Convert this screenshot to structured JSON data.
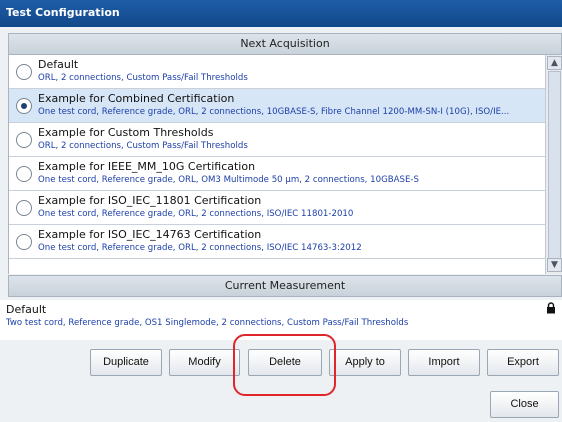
{
  "window": {
    "title": "Test Configuration"
  },
  "next_acquisition": {
    "header": "Next Acquisition",
    "items": [
      {
        "title": "Default",
        "description": "ORL, 2 connections, Custom Pass/Fail Thresholds",
        "selected": false
      },
      {
        "title": "Example for Combined Certification",
        "description": "One test cord, Reference grade, ORL, 2 connections, 10GBASE-S, Fibre Channel 1200-MM-SN-I (10G), ISO/IE...",
        "selected": true
      },
      {
        "title": "Example for Custom Thresholds",
        "description": "ORL, 2 connections, Custom Pass/Fail Thresholds",
        "selected": false
      },
      {
        "title": "Example for IEEE_MM_10G Certification",
        "description": "One test cord, Reference grade, ORL, OM3 Multimode 50 µm, 2 connections, 10GBASE-S",
        "selected": false
      },
      {
        "title": "Example for ISO_IEC_11801 Certification",
        "description": "One test cord, Reference grade, ORL, 2 connections, ISO/IEC 11801-2010",
        "selected": false
      },
      {
        "title": "Example for ISO_IEC_14763 Certification",
        "description": "One test cord, Reference grade, ORL, 2 connections, ISO/IEC 14763-3:2012",
        "selected": false
      }
    ]
  },
  "current_measurement": {
    "header": "Current Measurement",
    "title": "Default",
    "description": "Two test cord, Reference grade, OS1 Singlemode, 2 connections, Custom Pass/Fail Thresholds"
  },
  "buttons": {
    "duplicate": "Duplicate",
    "modify": "Modify",
    "delete": "Delete",
    "apply_to": "Apply to",
    "import": "Import",
    "export": "Export",
    "close": "Close"
  },
  "icons": {
    "scroll_up": "chevron-up-icon",
    "scroll_down": "chevron-down-icon",
    "lock": "lock-icon"
  },
  "colors": {
    "titlebar": "#1a5398",
    "selected_row": "#d6e6f7",
    "description_text": "#1c3fa8",
    "annotation": "#e0262a"
  }
}
